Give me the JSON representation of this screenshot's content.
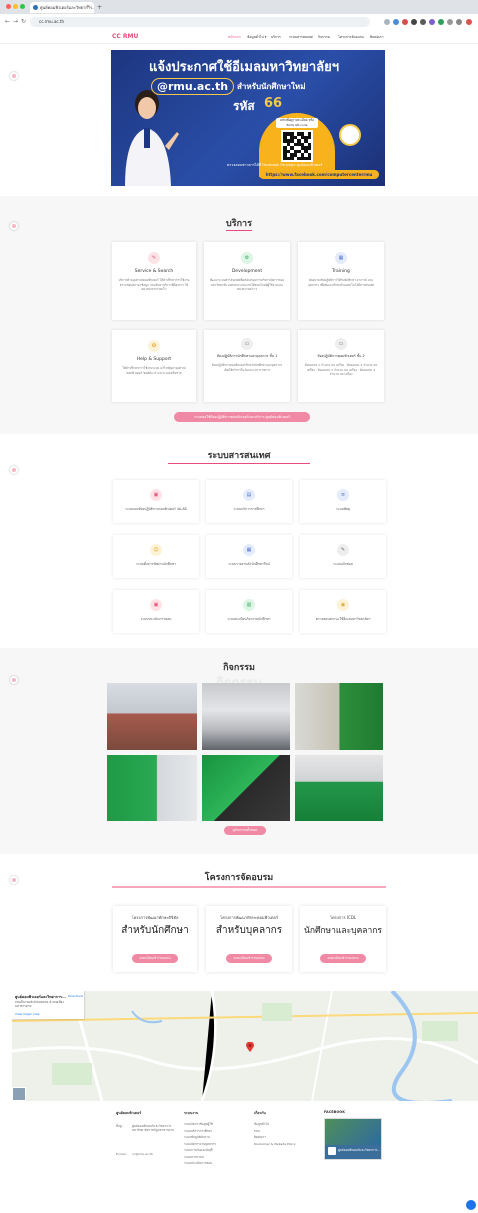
{
  "browser": {
    "tab_title": "ศูนย์คอมพิวเตอร์และวิทยาการ...",
    "url": "cc.rmu.ac.th"
  },
  "nav": {
    "logo": "CC RMU",
    "items": [
      "หน้าแรก",
      "ข้อมูลทั่วไป ▾",
      "บริการ",
      "ระบบสารสนเทศ",
      "กิจกรรม",
      "โครงการจัดอบรม",
      "ติดต่อเรา"
    ]
  },
  "banner": {
    "title": "แจ้งประกาศใช้อีเมลมหาวิทยาลัยฯ",
    "email": "@rmu.ac.th",
    "subtitle": "สำหรับนักศึกษาใหม่",
    "code_label": "รหัส",
    "code_value": "66",
    "qr_label": "คลิกเพื่อดูรายละเอียด หรือ สแกน QR-code",
    "fb_text": "ตรวจสอบข่าวสารได้ที่ Facebook Fanpage ศูนย์คอมพิวเตอร์",
    "fb_url": "https://www.facebook.com/computercenterrmu"
  },
  "services": {
    "title": "บริการ",
    "cards": [
      {
        "title": "Service & Search",
        "text": "บริการด้านอุปกรณ์คอมพิวเตอร์ ให้คำปรึกษาการใช้งาน ตรวจสอบสถานะข้อมูล และค้นหาบริการที่ต้องการ ได้อย่างสะดวกรวดเร็ว"
      },
      {
        "title": "Development",
        "text": "พัฒนาระบบสารสนเทศเพื่อสนับสนุนการบริหารจัดการของมหาวิทยาลัย ออกแบบระบบงานให้ตอบโจทย์ผู้ใช้งานและหน่วยงานต่าง ๆ"
      },
      {
        "title": "Training",
        "text": "จัดอบรมเชิงปฏิบัติการให้กับนักศึกษา อาจารย์ และบุคลากร เพื่อพัฒนาทักษะด้านเทคโนโลยีสารสนเทศ"
      },
      {
        "title": "Help & Support",
        "text": "ให้คำปรึกษาการใช้งานระบบ แก้ไขปัญหาอุปกรณ์คอมพิวเตอร์ ซอฟต์แวร์ และระบบเครือข่าย"
      },
      {
        "title": "ห้องปฏิบัติการนักศึกษาและบุคลากร ชั้น 1",
        "text": "ห้องปฏิบัติการคอมพิวเตอร์สำหรับนักศึกษาและบุคลากร เปิดให้บริการในวันและเวลาราชการ"
      },
      {
        "title": "ห้องปฏิบัติการคอมพิวเตอร์ ชั้น 2",
        "text": "ห้องอบรม 1 จำนวน 50 เครื่อง · ห้องอบรม 2 จำนวน 50 เครื่อง · ห้องอบรม 3 จำนวน 50 เครื่อง · ห้องอบรม 4 จำนวน 40 เครื่อง"
      }
    ],
    "button": "ระบบขอใช้ห้องปฏิบัติการคอมพิวเตอร์และบริการ ศูนย์คอมพิวเตอร์"
  },
  "systems": {
    "title": "ระบบสารสนเทศ",
    "cards": [
      "ระบบจองห้องปฏิบัติการคอมพิวเตอร์ 4A-AB",
      "ระบบบริการการศึกษา",
      "ระบบพัสดุ",
      "ระบบตั้งค่ารหัสผ่านนักศึกษา",
      "ระบบรายงานตัวนักศึกษาใหม่",
      "ระบบแจ้งซ่อม",
      "ระบบประเมินการสอน",
      "ระบบทะเบียนกิจกรรมนักศึกษา",
      "ตรวจสอบสถานะใช้อีเมลมหาวิทยาลัยฯ"
    ]
  },
  "activities": {
    "title": "กิจกรรม",
    "watermark": "กิจกรรม",
    "button": "ดูกิจกรรมทั้งหมด"
  },
  "training": {
    "title": "โครงการจัดอบรม",
    "cards": [
      {
        "sub": "โครงการพัฒนาทักษะดิจิทัล",
        "big": "สำหรับนักศึกษา",
        "button": "ลงทะเบียนเข้าร่วมอบรม"
      },
      {
        "sub": "โครงการพัฒนาทักษะคอมพิวเตอร์",
        "big": "สำหรับบุคลากร",
        "button": "ลงทะเบียนเข้าร่วมอบรม"
      },
      {
        "sub": "โครงการ ICDL",
        "big": "นักศึกษาและบุคลากร",
        "button": "ลงทะเบียนเข้าร่วมอบรม"
      }
    ]
  },
  "map": {
    "place": "ศูนย์คอมพิวเตอร์และวิทยาการ...",
    "address": "ถนนถีนานนท์ ตำบลตลาด อำเภอเมือง มหาสารคาม",
    "link": "View larger map",
    "directions": "Directions"
  },
  "footer": {
    "col1_head": "ศูนย์คอมพิวเตอร์",
    "address_label": "ที่อยู่ :",
    "address": "ศูนย์คอมพิวเตอร์และวิทยาการ มหาวิทยาลัยราชภัฏมหาสารคาม",
    "email_label": "E-mail :",
    "email": "cc@rmu.ac.th",
    "col2_head": "ระบบงาน",
    "col2_items": [
      "ระบบจัดการข้อมูลผู้ใช้",
      "ระบบบริการการศึกษา",
      "ระบบข้อมูลพนักงาน",
      "ระบบจัดการงานบุคลากร",
      "ระบบการเงินและบัญชี",
      "ระบบสารบรรณ",
      "ระบบประเมินการสอน"
    ],
    "col3_head": "เกี่ยวกับ",
    "col3_items": [
      "ข้อมูลทั่วไป",
      "FAQ",
      "ติดต่อเรา",
      "Disclaimer & Website Policy"
    ],
    "col4_head": "FACEBOOK",
    "fb_name": "ศูนย์คอมพิวเตอร์และวิทยาการ..."
  },
  "colors": {
    "accent": "#e94c7a",
    "button": "#f08aa4",
    "banner": "#1d3680",
    "gold": "#f7b21c"
  }
}
